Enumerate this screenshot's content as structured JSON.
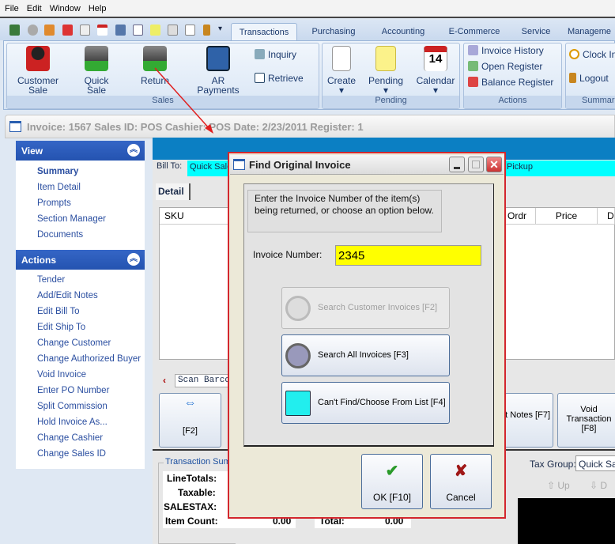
{
  "menu": [
    "File",
    "Edit",
    "Window",
    "Help"
  ],
  "tabs": [
    "Transactions",
    "Purchasing",
    "Accounting",
    "E-Commerce",
    "Service",
    "Manageme"
  ],
  "ribbon": {
    "sales": {
      "label": "Sales",
      "customer_sale": "Customer Sale",
      "quick_sale": "Quick Sale",
      "return": "Return",
      "ar_payments": "AR Payments",
      "inquiry": "Inquiry",
      "retrieve": "Retrieve"
    },
    "pending": {
      "label": "Pending",
      "create": "Create",
      "pending": "Pending",
      "calendar": "Calendar",
      "calendar_day": "14"
    },
    "actions": {
      "label": "Actions",
      "invoice_history": "Invoice History",
      "open_register": "Open Register",
      "balance_register": "Balance Register"
    },
    "summary": {
      "label": "Summar",
      "clock_in": "Clock In",
      "logout": "Logout"
    }
  },
  "invoice_bar": "Invoice: 1567  Sales ID: POS  Cashier: POS  Date:  2/23/2011  Register: 1",
  "sidebar": {
    "view": {
      "title": "View",
      "items": [
        "Summary",
        "Item Detail",
        "Prompts",
        "Section Manager",
        "Documents"
      ]
    },
    "actions": {
      "title": "Actions",
      "items": [
        "Tender",
        "Add/Edit Notes",
        "Edit Bill To",
        "Edit Ship To",
        "Change Customer",
        "Change Authorized Buyer",
        "Void Invoice",
        "Enter PO Number",
        "Split Commission",
        "Hold Invoice As...",
        "Change Cashier",
        "Change Sales ID"
      ]
    }
  },
  "main": {
    "bill_to_label": "Bill To:",
    "bill_to_value": "Quick Sale",
    "pickup": "Pickup",
    "detail_tab": "Detail",
    "columns": [
      "SKU",
      "Ordr",
      "Price",
      "D"
    ],
    "scan_placeholder": "Scan Barcode",
    "fbuttons": {
      "f2": "[F2]",
      "f7": "t Notes [F7]",
      "f8": "Void Transaction [F8]"
    },
    "summary_title": "Transaction Summary",
    "summary_rows": [
      "LineTotals:",
      "Taxable:",
      "SALESTAX:",
      "Item Count:"
    ],
    "item_count": "0.00",
    "total_label": "Total:",
    "total": "0.00",
    "tax_group_label": "Tax Group:",
    "tax_group_value": "Quick Sale",
    "up": "Up",
    "down": "D"
  },
  "dialog": {
    "title": "Find Original Invoice",
    "message": "Enter the Invoice Number of the item(s) being returned, or choose an option below.",
    "invoice_label": "Invoice Number:",
    "invoice_value": "2345",
    "search_customer": "Search Customer Invoices [F2]",
    "search_all": "Search All Invoices [F3]",
    "cant_find": "Can't Find/Choose From List [F4]",
    "ok": "OK [F10]",
    "cancel": "Cancel"
  },
  "colors": {
    "accent": "#0b7fc3",
    "highlight": "#d3272d",
    "input_bg": "#ffff00",
    "billto_bg": "#00ffff"
  }
}
